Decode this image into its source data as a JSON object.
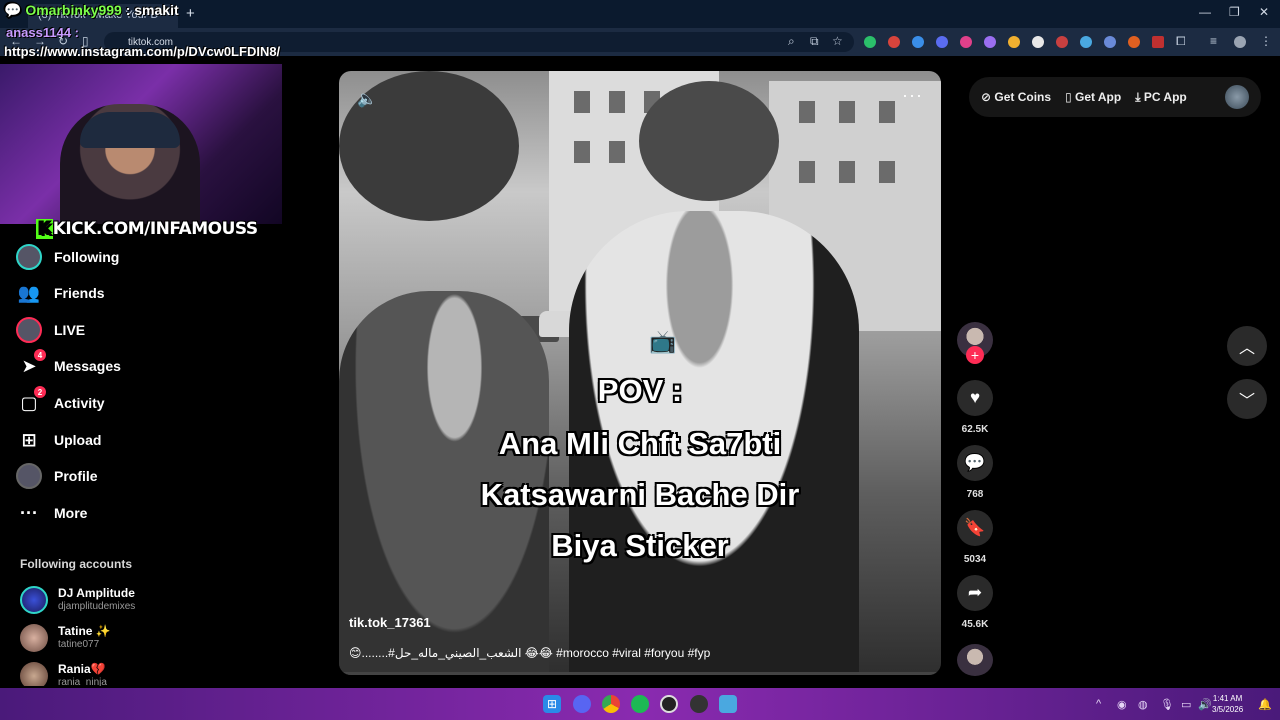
{
  "browser": {
    "tab_title": "(8) TikTok - Make Your D",
    "url": "tiktok.com"
  },
  "overlay": {
    "chat_user1": "Omarbinky999",
    "chat_text1": ": smakit",
    "chat_user2": "anass1144 :",
    "chat_link": "https://www.instagram.com/p/DVcw0LFDIN8/",
    "kick_brand": "KICK.COM/INFAMOUSS"
  },
  "sidebar": {
    "items": [
      {
        "label": "Following",
        "icon": "following-avatar-icon"
      },
      {
        "label": "Friends",
        "icon": "friends-icon"
      },
      {
        "label": "LIVE",
        "icon": "live-avatar-icon"
      },
      {
        "label": "Messages",
        "icon": "messages-icon",
        "badge": "4"
      },
      {
        "label": "Activity",
        "icon": "activity-icon",
        "badge": "2"
      },
      {
        "label": "Upload",
        "icon": "upload-icon"
      },
      {
        "label": "Profile",
        "icon": "profile-avatar-icon"
      },
      {
        "label": "More",
        "icon": "more-icon"
      }
    ],
    "following_title": "Following accounts",
    "accounts": [
      {
        "name": "DJ Amplitude",
        "handle": "djamplitudemixes"
      },
      {
        "name": "Tatine ✨",
        "handle": "tatine077"
      },
      {
        "name": "Rania💔",
        "handle": "rania_ninja"
      }
    ]
  },
  "video": {
    "caption_lines": [
      "POV :",
      "Ana Mli Chft Sa7bti",
      "Katsawarni Bache Dir",
      "Biya Sticker"
    ],
    "author": "tik.tok_17361",
    "description": "😊........#الشعب_الصيني_ماله_حل 😂😂 #morocco #viral #foryou #fyp"
  },
  "actions": {
    "likes": "62.5K",
    "comments": "768",
    "saves": "5034",
    "shares": "45.6K"
  },
  "header": {
    "get_coins": "Get Coins",
    "get_app": "Get App",
    "pc_app": "PC App"
  },
  "taskbar": {
    "time": "1:41 AM",
    "date": "3/5/2026"
  },
  "colors": {
    "accent": "#fe2c55",
    "kick_green": "#53fc18",
    "taskbar": "#8a2ab0"
  }
}
